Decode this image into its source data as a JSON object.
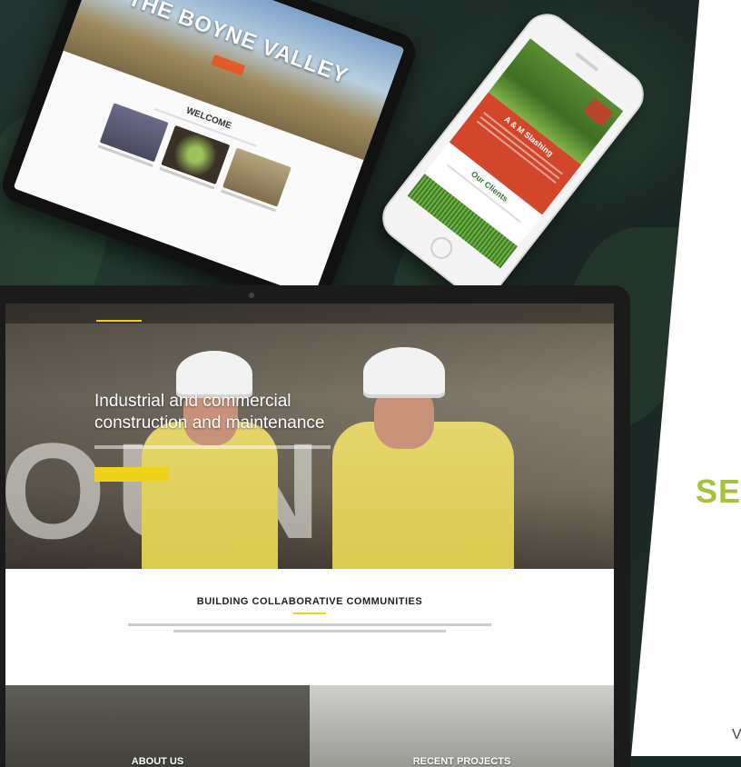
{
  "tablet": {
    "hero_subtitle": "",
    "hero_title": "THE BOYNE VALLEY",
    "welcome": "WELCOME"
  },
  "phone": {
    "red_heading": "A & M Slashing",
    "clients_heading": "Our Clients"
  },
  "laptop": {
    "hero_heading": "Industrial and commercial construction and maintenance",
    "section_heading": "BUILDING COLLABORATIVE COMMUNITIES",
    "tile_about": "ABOUT US",
    "tile_projects": "RECENT PROJECTS"
  },
  "right_panel": {
    "headline_fragment": "SE",
    "bottom_letter": "V"
  },
  "colors": {
    "accent_green": "#a6c23a",
    "cta_yellow": "#f0d21a",
    "phone_red": "#d2472c"
  }
}
